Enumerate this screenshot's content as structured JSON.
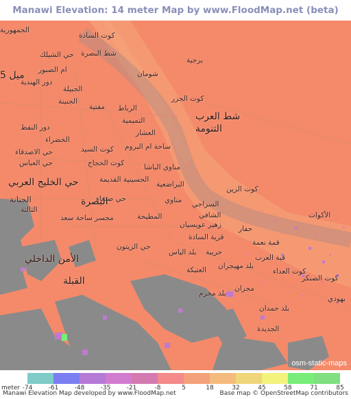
{
  "title": "Manawi Elevation: 14 meter Map by www.FloodMap.net (beta)",
  "map": {
    "place_labels": [
      "كوت السادة",
      "شط البصرة",
      "برجية",
      "شومان",
      "شط العرب",
      "التنومة",
      "كوت الجزر",
      "الرباط",
      "التميمية",
      "العشار",
      "ساحة ام البروم",
      "كوت السيد",
      "كوت الحجاج",
      "مناوي الباشا",
      "البراضعية",
      "الحسينية القديمة",
      "حي صنعاء",
      "مناوي",
      "البصرة",
      "حي الخليج العربي",
      "الجنانة",
      "مجسر ساحة سعد",
      "المطيحة",
      "السراجي",
      "الشافي",
      "زهير عويسيان",
      "كوت الزين",
      "الأكوات",
      "حفار",
      "قرية السادة",
      "قمة نعمة",
      "قبة العرب",
      "بلد مهيجران",
      "حريبة",
      "بلد الياس",
      "العتيكة",
      "بلد مخرم",
      "مجران",
      "كوت العداء",
      "كوت الصنكر",
      "بلد حمدان",
      "الجديدة",
      "حي الزيتون",
      "القبلة",
      "الأمن الداخلي",
      "الثالثة",
      "حي الاصدقاء",
      "حي العباس",
      "دور النفط",
      "الجمهورية",
      "دور الهندية",
      "ام الصبور",
      "حي الشيلك",
      "الجبيلة",
      "الجنينة",
      "مفتية",
      "الخضراء",
      "5 ميل",
      "بهودي"
    ],
    "attribution": "osm-static-maps"
  },
  "legend": {
    "unit_label": "meter",
    "colors": [
      "#7ecbc8",
      "#7b7ef0",
      "#b57ad6",
      "#d27ccf",
      "#d47ab0",
      "#f48a8a",
      "#f3a17a",
      "#f5bb7e",
      "#efd67a",
      "#f3f27c",
      "#78ee78",
      "#7ee07e"
    ],
    "tick_labels": [
      "-74",
      "-61",
      "-48",
      "-35",
      "-21",
      "-8",
      "5",
      "18",
      "32",
      "45",
      "58",
      "71",
      "85"
    ]
  },
  "footer": {
    "left": "Manawi Elevation Map developed by www.FloodMap.net",
    "right": "Base map © OpenStreetMap contributors"
  }
}
